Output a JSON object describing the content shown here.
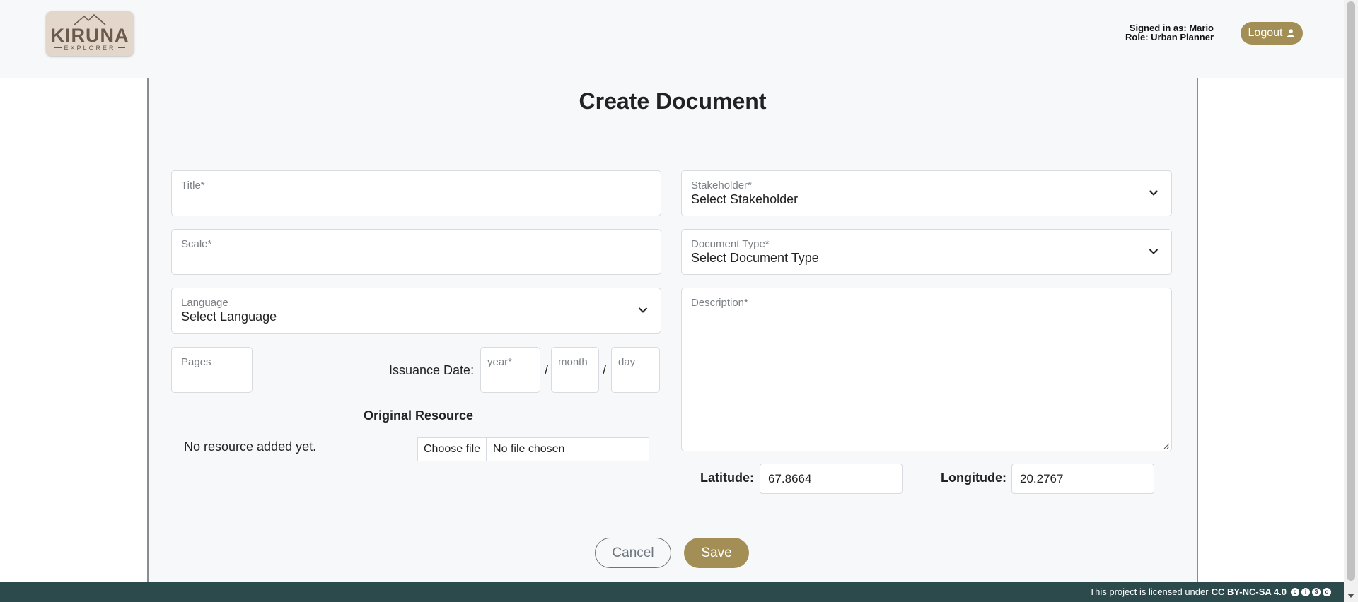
{
  "header": {
    "logo_text": "KIRUNA",
    "logo_subtext": "EXPLORER",
    "signed_in_label": "Signed in as: Mario",
    "role_label": "Role: Urban Planner",
    "logout_label": "Logout"
  },
  "form": {
    "title": "Create Document",
    "title_field": {
      "label": "Title*",
      "value": ""
    },
    "scale_field": {
      "label": "Scale*",
      "value": ""
    },
    "language_field": {
      "label": "Language",
      "value": "Select Language"
    },
    "pages_field": {
      "label": "Pages",
      "value": ""
    },
    "issuance_date": {
      "label": "Issuance Date:",
      "year_placeholder": "year*",
      "month_placeholder": "month",
      "day_placeholder": "day",
      "separator": "/"
    },
    "stakeholder_field": {
      "label": "Stakeholder*",
      "value": "Select Stakeholder"
    },
    "document_type_field": {
      "label": "Document Type*",
      "value": "Select Document Type"
    },
    "description_field": {
      "label": "Description*",
      "value": ""
    },
    "original_resource": {
      "heading": "Original Resource",
      "empty_text": "No resource added yet.",
      "choose_file_label": "Choose file",
      "no_file_label": "No file chosen"
    },
    "latitude": {
      "label": "Latitude:",
      "value": "67.8664"
    },
    "longitude": {
      "label": "Longitude:",
      "value": "20.2767"
    },
    "cancel_label": "Cancel",
    "save_label": "Save"
  },
  "footer": {
    "text": "This project is licensed under",
    "license": "CC BY-NC-SA 4.0",
    "icons": [
      "cc-icon",
      "by-icon",
      "nc-icon",
      "sa-icon"
    ]
  },
  "colors": {
    "accent": "#a38f55",
    "footer_bg": "#2c4a4c",
    "panel_bg": "#f7f8f9",
    "logo_bg": "#e3d6ca"
  }
}
